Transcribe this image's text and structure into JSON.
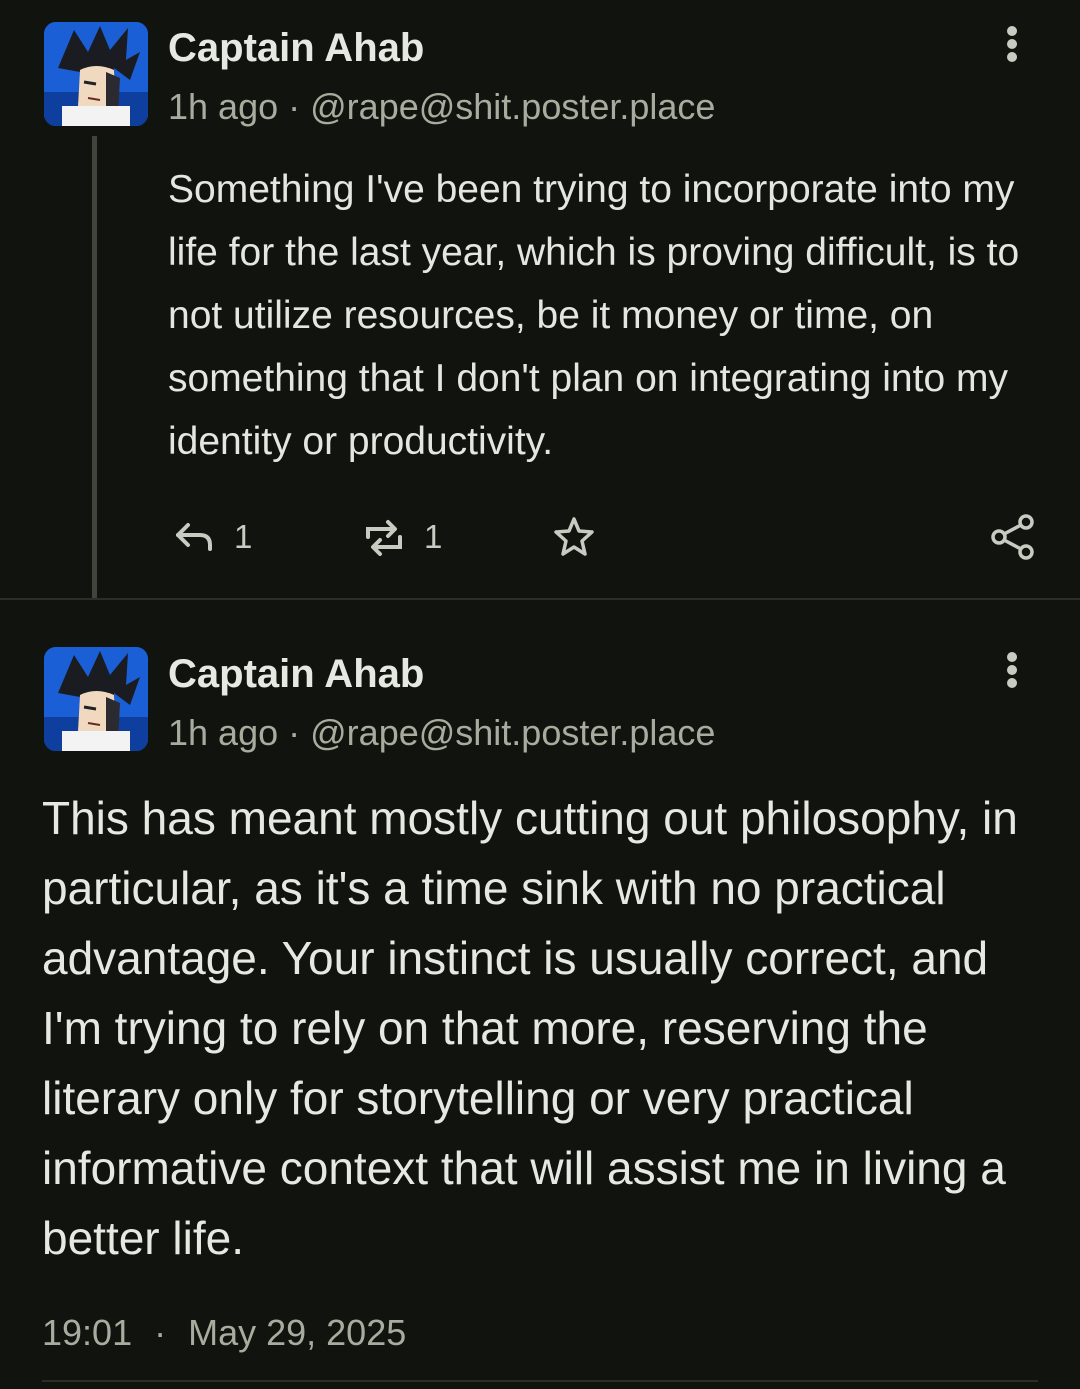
{
  "posts": [
    {
      "author": "Captain Ahab",
      "time": "1h ago",
      "separator": "·",
      "handle": "@rape@shit.poster.place",
      "body": "Something I've been trying to incorporate into my life for the last year, which is proving difficult, is to not utilize resources, be it money or time, on something that I don't plan on integrating into my identity or productivity.",
      "actions": {
        "reply_icon": "reply-icon",
        "reply_count": "1",
        "boost_icon": "boost-icon",
        "boost_count": "1",
        "favorite_icon": "star-icon",
        "share_icon": "share-icon"
      }
    },
    {
      "author": "Captain Ahab",
      "time": "1h ago",
      "separator": "·",
      "handle": "@rape@shit.poster.place",
      "body": "This has meant mostly cutting out philosophy, in particular, as it's a time sink with no practical advantage. Your instinct is usually correct, and I'm trying to rely on that more, reserving the literary only for storytelling or very practical informative context that will assist me in living a better life.",
      "posted_time": "19:01",
      "posted_sep": "·",
      "posted_date": "May 29, 2025"
    }
  ],
  "colors": {
    "background": "#11140e",
    "text": "#e4e6df",
    "muted": "#a8ac9f",
    "avatar_blue": "#1a5fd6"
  }
}
